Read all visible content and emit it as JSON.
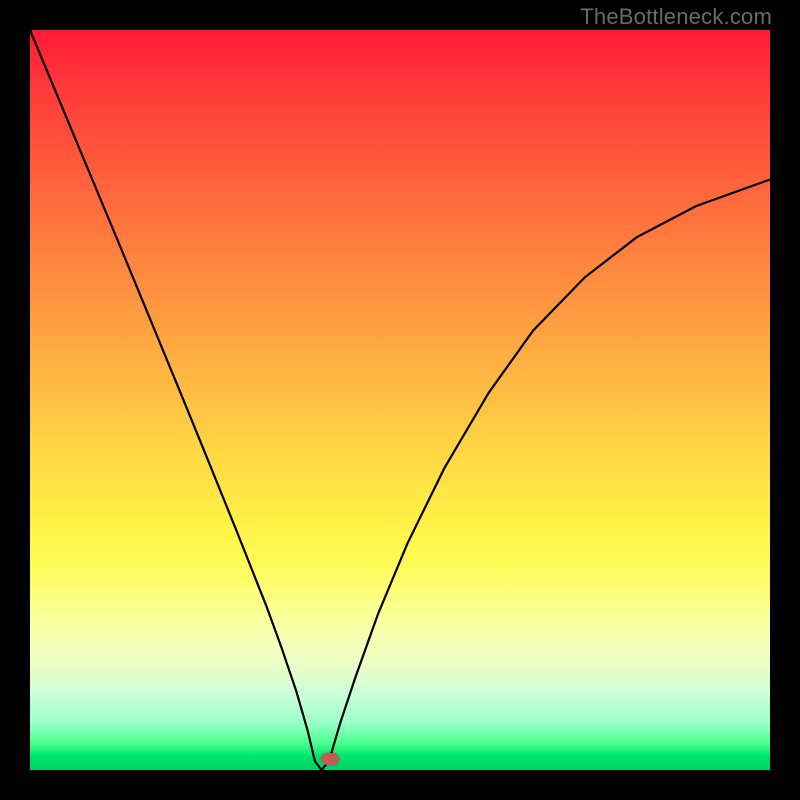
{
  "watermark": "TheBottleneck.com",
  "chart_data": {
    "type": "line",
    "title": "",
    "xlabel": "",
    "ylabel": "",
    "xlim": [
      0,
      100
    ],
    "ylim": [
      0,
      100
    ],
    "x": [
      0,
      2,
      5,
      8,
      12,
      16,
      20,
      24,
      28,
      32,
      34,
      36,
      37.5,
      38.5,
      39.4,
      40.4,
      42,
      44,
      47,
      51,
      56,
      62,
      68,
      75,
      82,
      90,
      100
    ],
    "values": [
      100,
      95.2,
      88,
      80.8,
      71.2,
      61.5,
      51.8,
      42,
      32.1,
      22,
      16.5,
      10.6,
      5.4,
      1.2,
      0,
      1.2,
      6.6,
      12.6,
      21,
      30.6,
      40.8,
      51,
      59.4,
      66.6,
      72,
      76.2,
      79.8
    ],
    "annotations": [
      {
        "type": "marker",
        "x": 40.5,
        "y": 1.5,
        "color": "#c65a52"
      }
    ],
    "grid": false,
    "legend": false,
    "note": "Axis labels and tick values are not shown on the source image; x and y are treated as percent-of-plot-area coordinates read from pixel positions."
  }
}
